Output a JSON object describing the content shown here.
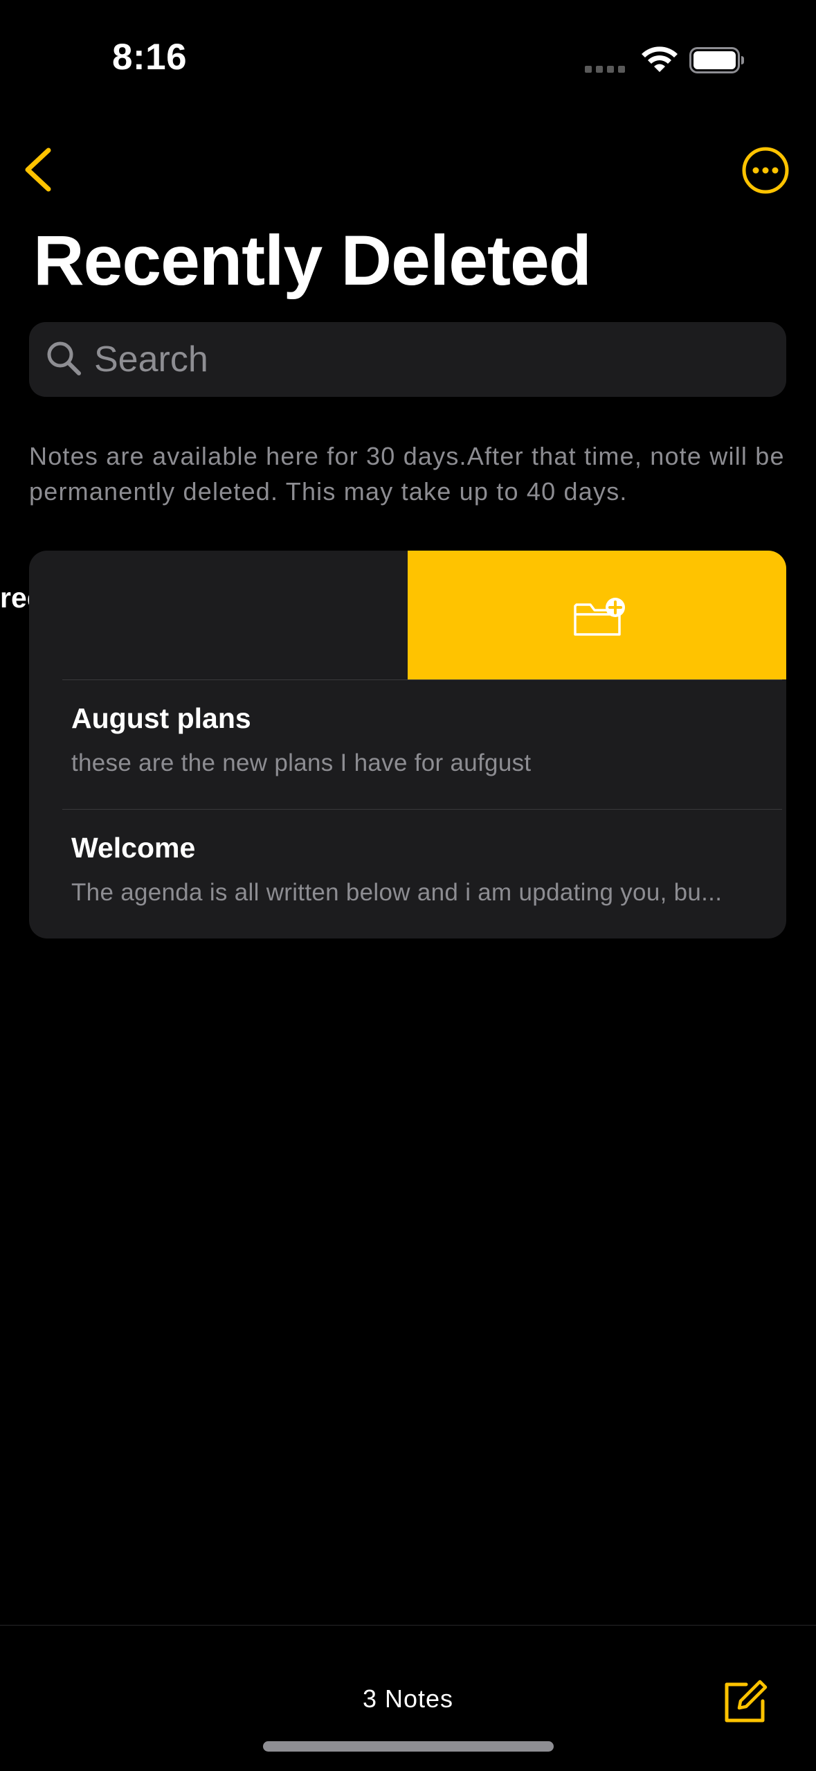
{
  "status_bar": {
    "time": "8:16",
    "wifi_icon": "wifi-icon",
    "battery_icon": "battery-icon"
  },
  "nav": {
    "back_icon": "chevron-left-icon",
    "more_icon": "ellipsis-circle-icon"
  },
  "page": {
    "title": "Recently Deleted"
  },
  "search": {
    "placeholder": "Search",
    "value": ""
  },
  "info": {
    "text": "Notes are available here for 30 days.After that time, note will be permanently deleted. This may take up to 40 days."
  },
  "notes": {
    "swiped_row_title_fragment": "ree",
    "swipe_action_icon": "folder-add-icon",
    "items": [
      {
        "title": "August plans",
        "snippet": "these are the new plans I have for aufgust"
      },
      {
        "title": "Welcome",
        "snippet": "The agenda is all written below and i am updating you, bu..."
      }
    ]
  },
  "toolbar": {
    "count_label": "3 Notes",
    "compose_icon": "compose-icon"
  },
  "colors": {
    "accent": "#FFC300",
    "background": "#000000",
    "card": "#1C1C1E",
    "secondary_text": "#8D8D92"
  }
}
